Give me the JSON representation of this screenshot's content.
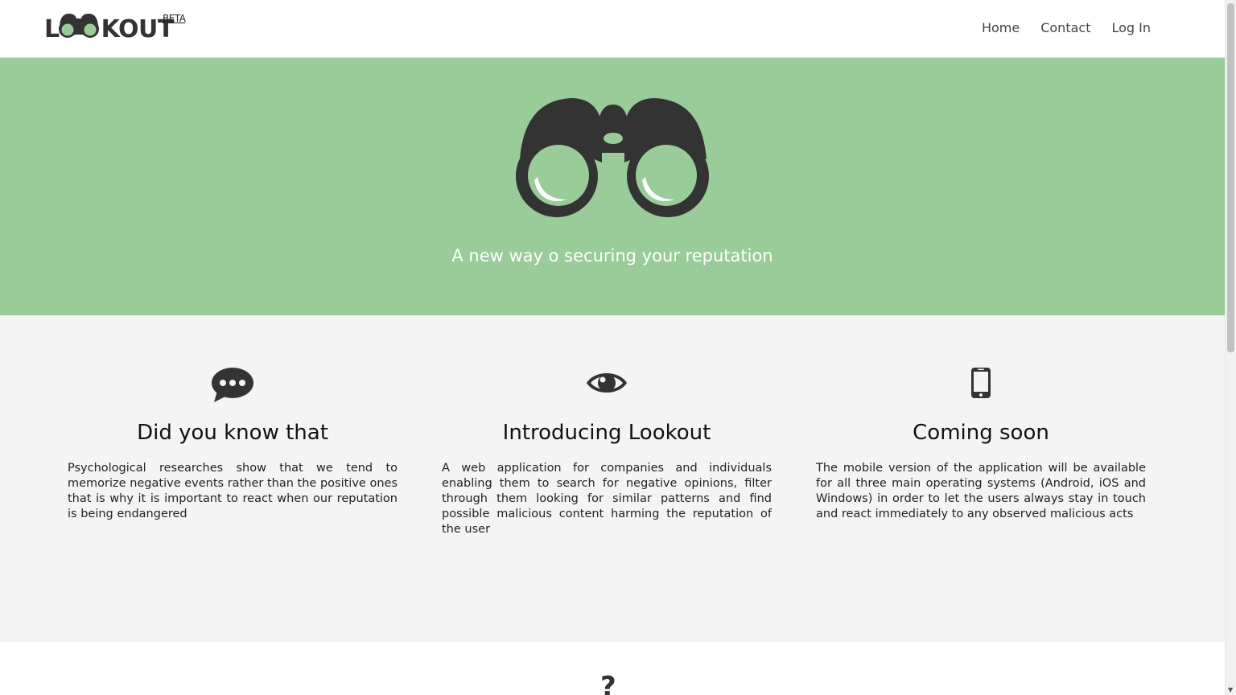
{
  "header": {
    "logo_text_left": "L",
    "logo_text_right": "KOUT",
    "logo_beta": "BETA",
    "nav": [
      {
        "label": "Home"
      },
      {
        "label": "Contact"
      },
      {
        "label": "Log In"
      }
    ]
  },
  "hero": {
    "tagline": "A new way o securing your reputation",
    "background": "#99cc99"
  },
  "features": [
    {
      "icon": "chat-bubble-icon",
      "title": "Did you know that",
      "text": "Psychological researches show that we tend to memorize negative events rather than the positive ones that is why it is important to react when our reputation is being endangered"
    },
    {
      "icon": "eye-icon",
      "title": "Introducing Lookout",
      "text": "A web application for companies and individuals enabling them to search for negative opinions, filter through them looking for similar patterns and find possible malicious content harming the reputation of the user"
    },
    {
      "icon": "mobile-phone-icon",
      "title": "Coming soon",
      "text": "The mobile version of the application will be available for all three main operating systems (Android, iOS and Windows) in order to let the users always stay in touch and react immediately to any observed malicious acts"
    }
  ],
  "next_section": {
    "icon": "question-mark-icon"
  },
  "colors": {
    "accent": "#99cc99",
    "dark": "#333333",
    "section_bg": "#f4f4f4"
  }
}
